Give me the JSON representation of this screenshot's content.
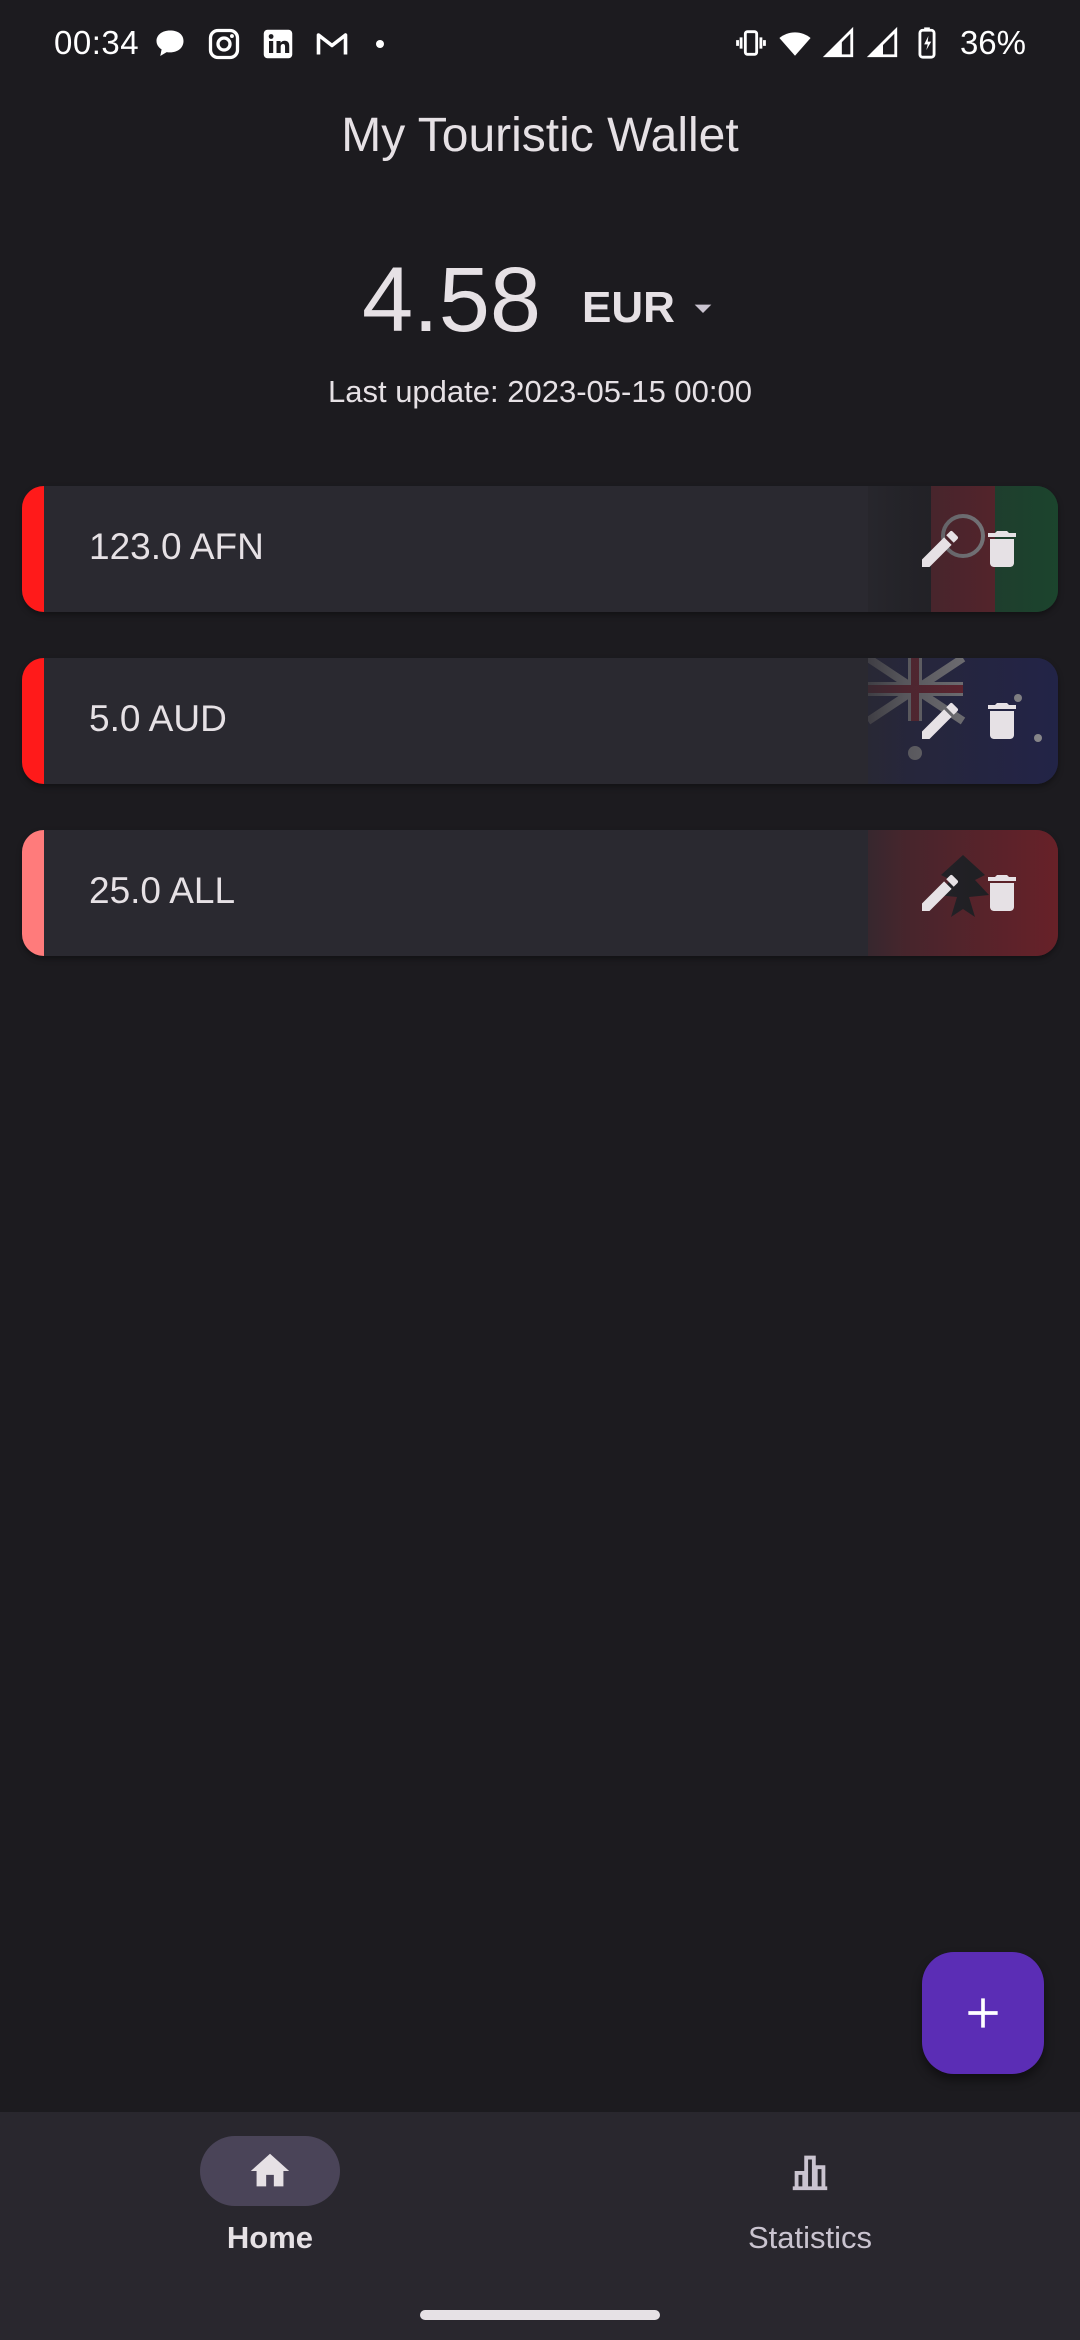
{
  "status_bar": {
    "time": "00:34",
    "battery_pct": "36%",
    "left_icons": [
      "messages-icon",
      "instagram-icon",
      "linkedin-icon",
      "gmail-icon",
      "dot-icon"
    ],
    "right_icons": [
      "vibrate-icon",
      "wifi-icon",
      "signal-icon",
      "signal-icon",
      "battery-charging-icon"
    ]
  },
  "app": {
    "title": "My Touristic Wallet"
  },
  "balance": {
    "amount": "4.58",
    "currency": "EUR",
    "last_update": "Last update: 2023-05-15 00:00"
  },
  "wallet_items": [
    {
      "label": "123.0 AFN",
      "accent": "#ff1a1a",
      "flag": "Afghanistan"
    },
    {
      "label": "5.0 AUD",
      "accent": "#ff1a1a",
      "flag": "Australia"
    },
    {
      "label": "25.0 ALL",
      "accent": "#ff7b7b",
      "flag": "Albania"
    }
  ],
  "fab": {
    "icon": "plus-icon"
  },
  "bottom_nav": {
    "items": [
      {
        "label": "Home",
        "icon": "home-icon",
        "selected": true
      },
      {
        "label": "Statistics",
        "icon": "bar-chart-icon",
        "selected": false
      }
    ]
  },
  "colors": {
    "background": "#1c1b1f",
    "card": "#2a2930",
    "accent_fab": "#5b2db5",
    "nav_bar": "#29272e",
    "nav_selected_pill": "#4a4458"
  }
}
